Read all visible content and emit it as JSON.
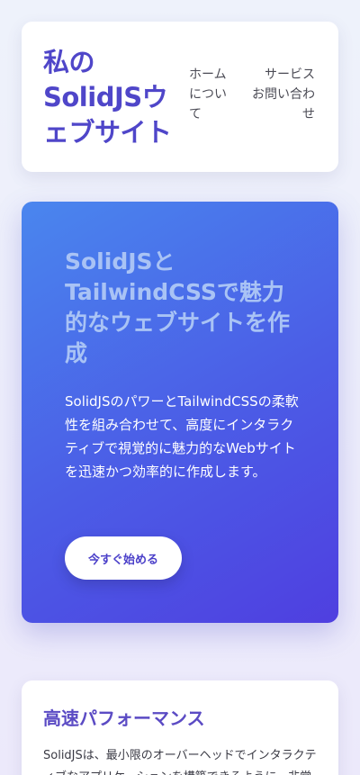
{
  "header": {
    "site_title": "私のSolidJSウェブサイト",
    "nav": {
      "home": "ホーム",
      "about": "について",
      "services": "サービス",
      "contact": "お問い合わせ"
    }
  },
  "hero": {
    "title": "SolidJSとTailwindCSSで魅力的なウェブサイトを作成",
    "description": "SolidJSのパワーとTailwindCSSの柔軟性を組み合わせて、高度にインタラクティブで視覚的に魅力的なWebサイトを迅速かつ効率的に作成します。",
    "cta_label": "今すぐ始める"
  },
  "features": [
    {
      "title": "高速パフォーマンス",
      "text": "SolidJSは、最小限のオーバーヘッドでインタラクティブなアプリケーションを構築できるように、非常に"
    }
  ],
  "colors": {
    "accent": "#4f46c9",
    "hero_start": "#4a86ee",
    "hero_end": "#4f3fe0",
    "hero_title": "#a9c3f5"
  }
}
